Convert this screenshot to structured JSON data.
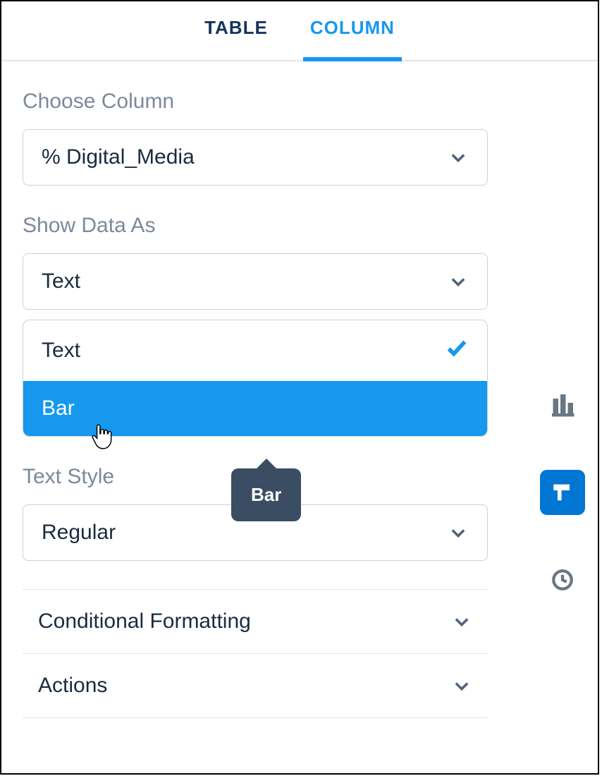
{
  "tabs": {
    "table": "TABLE",
    "column": "COLUMN"
  },
  "sections": {
    "choose_column": {
      "label": "Choose Column",
      "value": "% Digital_Media"
    },
    "show_data_as": {
      "label": "Show Data As",
      "value": "Text",
      "options": {
        "text": "Text",
        "bar": "Bar"
      },
      "tooltip": "Bar"
    },
    "text_style": {
      "label": "Text Style",
      "value": "Regular"
    },
    "conditional_formatting": "Conditional Formatting",
    "actions": "Actions"
  }
}
